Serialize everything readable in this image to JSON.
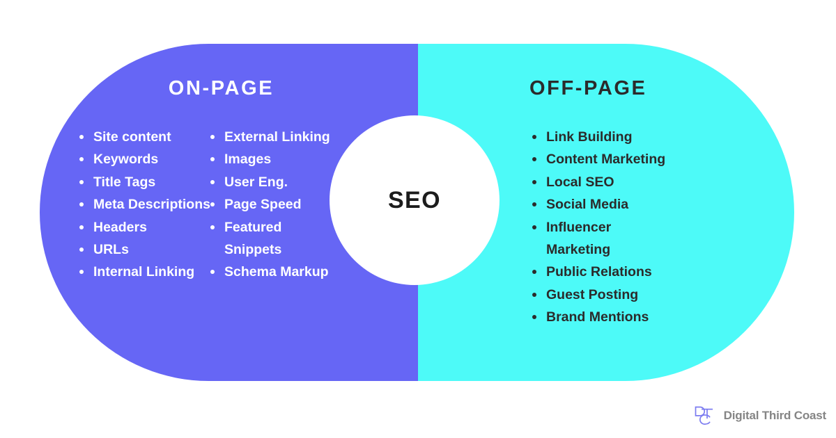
{
  "palette": {
    "on_page_bg": "#6666F5",
    "off_page_bg": "#4DFAF8",
    "circle_bg": "#FFFFFF",
    "dark_text": "#2B2B2B",
    "light_text": "#FFFFFF",
    "brand_gray": "#858585",
    "logo_purple": "#7B7BF0",
    "page_bg": "#FFFFFF"
  },
  "center": {
    "label": "SEO"
  },
  "on_page": {
    "title": "ON-PAGE",
    "column_1": [
      "Site content",
      "Keywords",
      "Title Tags",
      "Meta Descriptions",
      "Headers",
      "URLs",
      "Internal Linking"
    ],
    "column_2": [
      "External Linking",
      "Images",
      "User Eng.",
      "Page Speed",
      "Featured Snippets",
      "Schema Markup"
    ]
  },
  "off_page": {
    "title": "OFF-PAGE",
    "items": [
      "Link Building",
      "Content Marketing",
      "Local SEO",
      "Social Media",
      "Influencer Marketing",
      "Public Relations",
      "Guest Posting",
      "Brand Mentions"
    ]
  },
  "brand": {
    "name": "Digital Third Coast",
    "logo_letters": "DTC",
    "logo_icon": "dtc-monogram-icon"
  }
}
